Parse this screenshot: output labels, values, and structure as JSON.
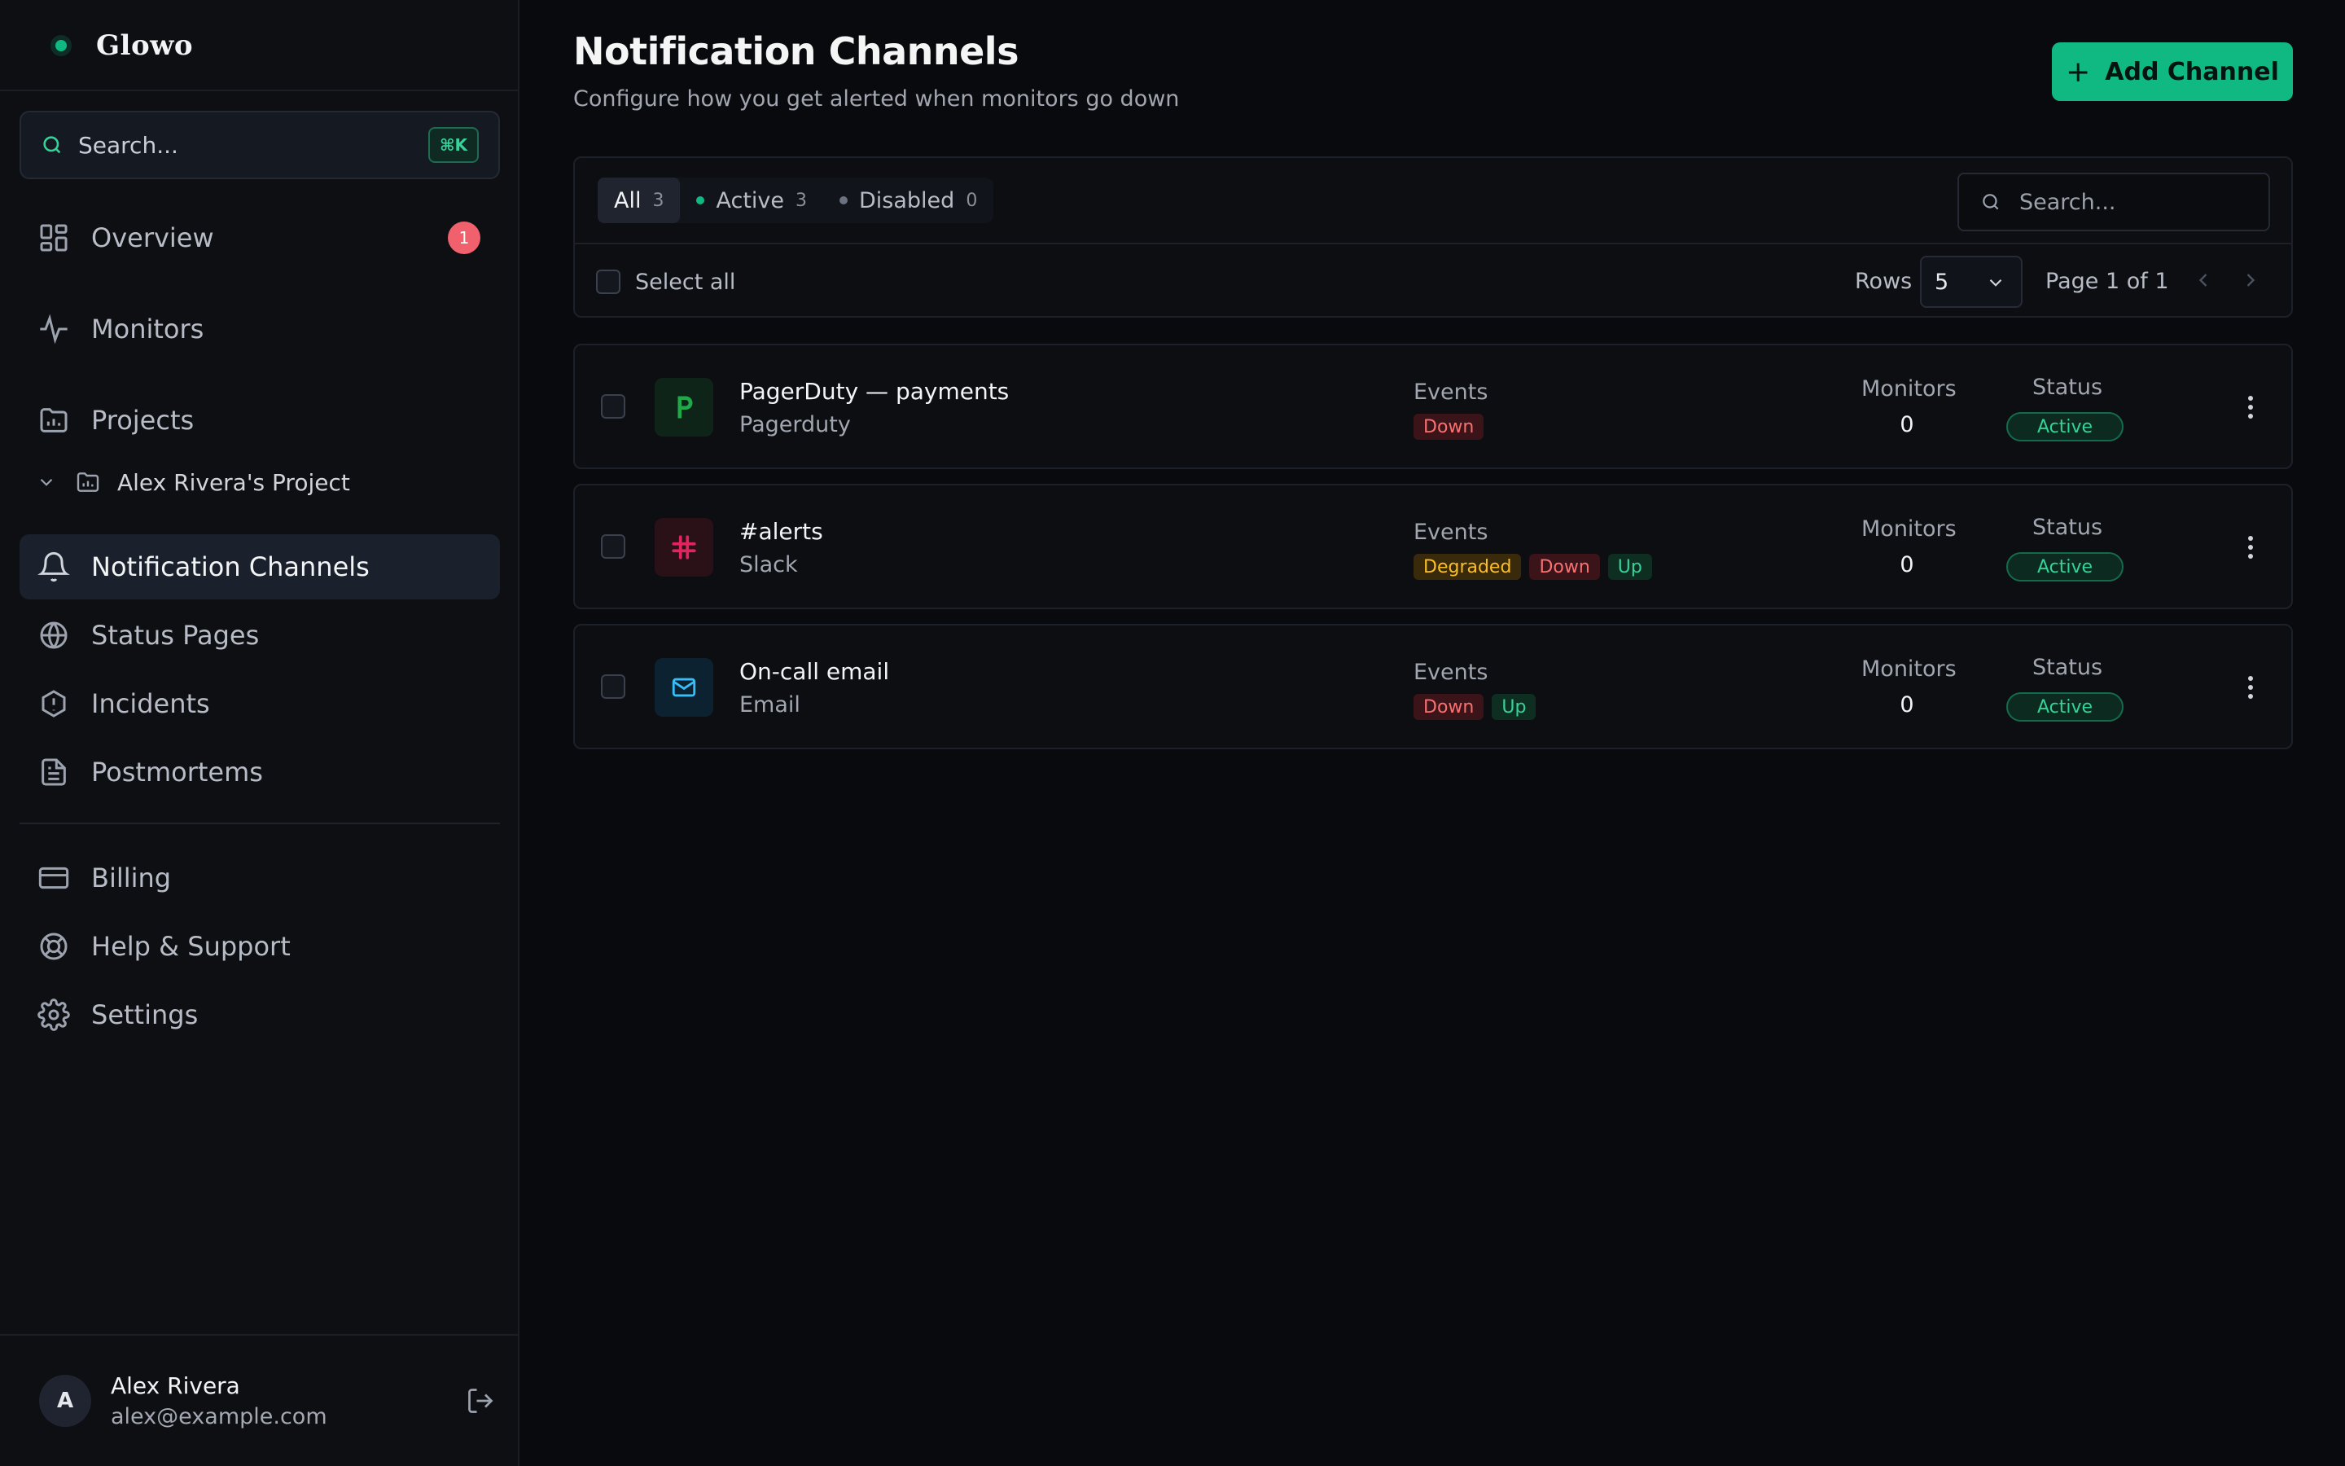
{
  "app": {
    "name": "Glowo"
  },
  "sidebar": {
    "search": {
      "placeholder": "Search...",
      "shortcut": "⌘K"
    },
    "items": [
      {
        "label": "Overview",
        "icon": "grid-icon",
        "badge": "1"
      },
      {
        "label": "Monitors",
        "icon": "activity-icon"
      },
      {
        "label": "Projects",
        "icon": "folder-chart-icon"
      },
      {
        "label": "Notification Channels",
        "icon": "bell-icon",
        "active": true
      },
      {
        "label": "Status Pages",
        "icon": "globe-icon"
      },
      {
        "label": "Incidents",
        "icon": "alert-circle-icon"
      },
      {
        "label": "Postmortems",
        "icon": "file-text-icon"
      },
      {
        "label": "Billing",
        "icon": "credit-card-icon"
      },
      {
        "label": "Help & Support",
        "icon": "life-buoy-icon"
      },
      {
        "label": "Settings",
        "icon": "gear-icon"
      }
    ],
    "project": {
      "label": "Alex Rivera's Project"
    },
    "user": {
      "initial": "A",
      "name": "Alex Rivera",
      "email": "alex@example.com"
    }
  },
  "header": {
    "title": "Notification Channels",
    "subtitle": "Configure how you get alerted when monitors go down",
    "add_button": "Add Channel"
  },
  "filters": {
    "tabs": [
      {
        "label": "All",
        "count": "3"
      },
      {
        "label": "Active",
        "count": "3"
      },
      {
        "label": "Disabled",
        "count": "0"
      }
    ],
    "search_placeholder": "Search...",
    "select_all": "Select all",
    "rows_label": "Rows",
    "rows_value": "5",
    "page_label": "Page 1 of 1"
  },
  "table": {
    "events_label": "Events",
    "monitors_label": "Monitors",
    "status_label": "Status",
    "rows": [
      {
        "name": "PagerDuty — payments",
        "type": "Pagerduty",
        "icon": "pagerduty-icon",
        "events": [
          "Down"
        ],
        "monitors": "0",
        "status": "Active"
      },
      {
        "name": "#alerts",
        "type": "Slack",
        "icon": "slack-icon",
        "events": [
          "Degraded",
          "Down",
          "Up"
        ],
        "monitors": "0",
        "status": "Active"
      },
      {
        "name": "On-call email",
        "type": "Email",
        "icon": "mail-icon",
        "events": [
          "Down",
          "Up"
        ],
        "monitors": "0",
        "status": "Active"
      }
    ]
  },
  "colors": {
    "accent": "#10b981",
    "badge": "#f0616d",
    "down": "#f87171",
    "up": "#34d399",
    "degraded": "#fbbf24"
  }
}
